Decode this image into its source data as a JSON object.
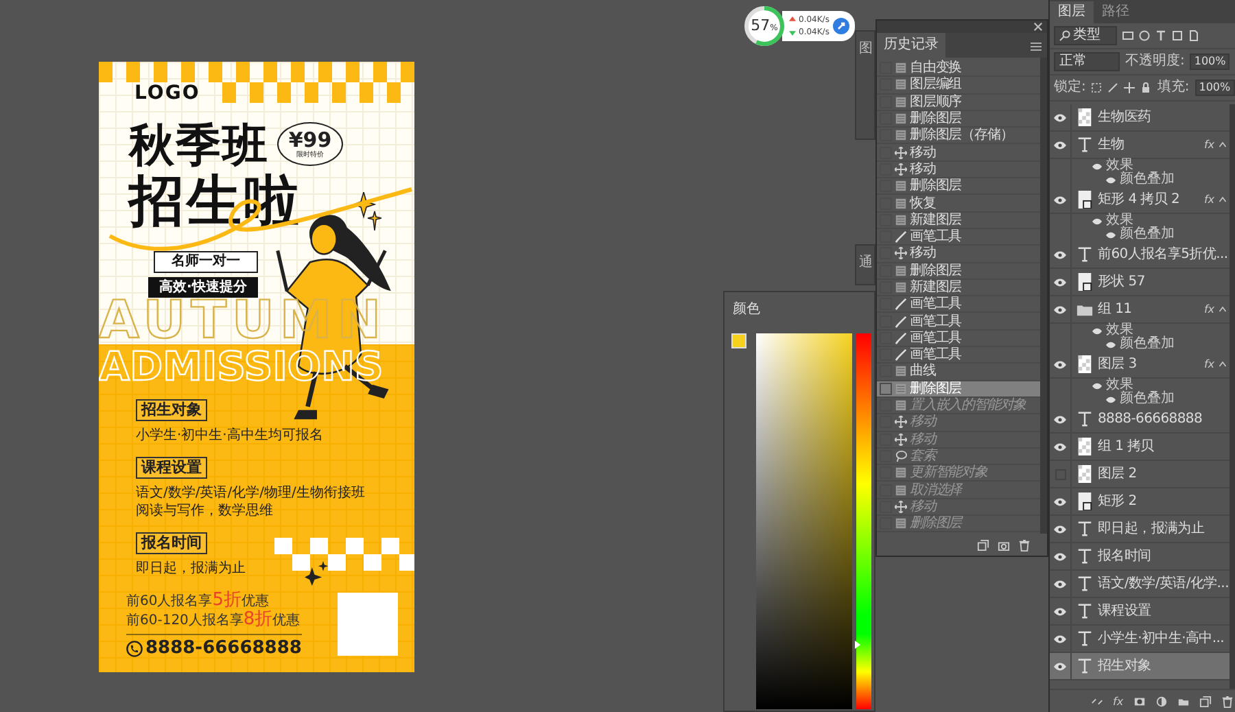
{
  "network_widget": {
    "usage": "57",
    "unit": "%",
    "level": 0.57,
    "upload": "0.04K/s",
    "download": "0.04K/s"
  },
  "poster": {
    "logo": "LOGO",
    "title_line1": "秋季班",
    "title_line2": "招生啦",
    "price": "¥99",
    "price_note": "限时特价",
    "tag1": "名师一对一",
    "tag2": "高效·快速提分",
    "bg_word1": "AUTUMN",
    "bg_word2": "ADMISSIONS",
    "sections": [
      {
        "heading": "招生对象",
        "lines": [
          "小学生·初中生·高中生均可报名"
        ]
      },
      {
        "heading": "课程设置",
        "lines": [
          "语文/数学/英语/化学/物理/生物衔接班",
          "阅读与写作，数学思维"
        ]
      },
      {
        "heading": "报名时间",
        "lines": [
          "即日起，报满为止"
        ]
      }
    ],
    "offers": [
      {
        "before": "前60人报名享",
        "highlight": "5折",
        "after": "优惠"
      },
      {
        "before": "前60-120人报名享",
        "highlight": "8折",
        "after": "优惠"
      }
    ],
    "phone": "8888-66668888"
  },
  "behind_panels": [
    {
      "tab": "图"
    },
    {
      "tab": "通"
    }
  ],
  "color_panel": {
    "title": "颜色",
    "hue_slider": {
      "level": 0.17
    }
  },
  "history_panel": {
    "title": "历史记录",
    "items": [
      {
        "label": "自由变换",
        "kind": "folder",
        "selected": false,
        "disabled": false
      },
      {
        "label": "图层编组",
        "kind": "folder",
        "selected": false,
        "disabled": false
      },
      {
        "label": "图层顺序",
        "kind": "folder",
        "selected": false,
        "disabled": false
      },
      {
        "label": "删除图层",
        "kind": "folder",
        "selected": false,
        "disabled": false
      },
      {
        "label": "删除图层（存储）",
        "kind": "folder",
        "selected": false,
        "disabled": false
      },
      {
        "label": "移动",
        "kind": "move",
        "selected": false,
        "disabled": false
      },
      {
        "label": "移动",
        "kind": "move",
        "selected": false,
        "disabled": false
      },
      {
        "label": "删除图层",
        "kind": "folder",
        "selected": false,
        "disabled": false
      },
      {
        "label": "恢复",
        "kind": "folder",
        "selected": false,
        "disabled": false
      },
      {
        "label": "新建图层",
        "kind": "folder",
        "selected": false,
        "disabled": false
      },
      {
        "label": "画笔工具",
        "kind": "brush",
        "selected": false,
        "disabled": false
      },
      {
        "label": "移动",
        "kind": "move",
        "selected": false,
        "disabled": false
      },
      {
        "label": "删除图层",
        "kind": "folder",
        "selected": false,
        "disabled": false
      },
      {
        "label": "新建图层",
        "kind": "folder",
        "selected": false,
        "disabled": false
      },
      {
        "label": "画笔工具",
        "kind": "brush",
        "selected": false,
        "disabled": false
      },
      {
        "label": "画笔工具",
        "kind": "brush",
        "selected": false,
        "disabled": false
      },
      {
        "label": "画笔工具",
        "kind": "brush",
        "selected": false,
        "disabled": false
      },
      {
        "label": "画笔工具",
        "kind": "brush",
        "selected": false,
        "disabled": false
      },
      {
        "label": "曲线",
        "kind": "folder",
        "selected": false,
        "disabled": false
      },
      {
        "label": "删除图层",
        "kind": "folder",
        "selected": true,
        "disabled": false
      },
      {
        "label": "置入嵌入的智能对象",
        "kind": "folder",
        "selected": false,
        "disabled": true
      },
      {
        "label": "移动",
        "kind": "move",
        "selected": false,
        "disabled": true
      },
      {
        "label": "移动",
        "kind": "move",
        "selected": false,
        "disabled": true
      },
      {
        "label": "套索",
        "kind": "lasso",
        "selected": false,
        "disabled": true
      },
      {
        "label": "更新智能对象",
        "kind": "folder",
        "selected": false,
        "disabled": true
      },
      {
        "label": "取消选择",
        "kind": "folder",
        "selected": false,
        "disabled": true
      },
      {
        "label": "移动",
        "kind": "move",
        "selected": false,
        "disabled": true
      },
      {
        "label": "删除图层",
        "kind": "folder",
        "selected": false,
        "disabled": true
      }
    ]
  },
  "layers_panel": {
    "tabs": [
      {
        "label": "图层",
        "selected": true
      },
      {
        "label": "路径",
        "selected": false
      }
    ],
    "filter": "类型",
    "blend_mode": "正常",
    "opacity_label": "不透明度:",
    "opacity": "100%",
    "lock_label": "锁定:",
    "fill_label": "填充:",
    "fill": "100%",
    "footer_fx": "fx",
    "layers": [
      {
        "name": "生物医药",
        "kind": "image",
        "visible": true,
        "selected": false
      },
      {
        "name": "生物",
        "kind": "text",
        "visible": true,
        "selected": false,
        "badge": "fx",
        "expanded": true,
        "effects": [
          {
            "label": "效果",
            "children": [
              {
                "label": "颜色叠加"
              }
            ]
          }
        ]
      },
      {
        "name": "矩形 4 拷贝 2",
        "kind": "shape",
        "visible": true,
        "selected": false,
        "badge": "fx",
        "expanded": true,
        "effects": [
          {
            "label": "效果",
            "children": [
              {
                "label": "颜色叠加"
              }
            ]
          }
        ]
      },
      {
        "name": "前60人报名享5折优...",
        "kind": "text",
        "visible": true,
        "selected": false
      },
      {
        "name": "形状 57",
        "kind": "shape",
        "visible": true,
        "selected": false
      },
      {
        "name": "组 11",
        "kind": "group",
        "visible": true,
        "selected": false,
        "badge": "fx",
        "expanded": true,
        "effects": [
          {
            "label": "效果",
            "children": [
              {
                "label": "颜色叠加"
              }
            ]
          }
        ]
      },
      {
        "name": "图层 3",
        "kind": "image",
        "visible": true,
        "selected": false,
        "badge": "fx",
        "expanded": true,
        "effects": [
          {
            "label": "效果",
            "children": [
              {
                "label": "颜色叠加"
              }
            ]
          }
        ]
      },
      {
        "name": "8888-66668888",
        "kind": "text",
        "visible": true,
        "selected": false
      },
      {
        "name": "组 1 拷贝",
        "kind": "image",
        "visible": true,
        "selected": false
      },
      {
        "name": "图层 2",
        "kind": "image",
        "visible": false,
        "selected": false
      },
      {
        "name": "矩形 2",
        "kind": "shape",
        "visible": true,
        "selected": false
      },
      {
        "name": "即日起，报满为止",
        "kind": "text",
        "visible": true,
        "selected": false
      },
      {
        "name": "报名时间",
        "kind": "text",
        "visible": true,
        "selected": false
      },
      {
        "name": "语文/数学/英语/化学...",
        "kind": "text",
        "visible": true,
        "selected": false
      },
      {
        "name": "课程设置",
        "kind": "text",
        "visible": true,
        "selected": false
      },
      {
        "name": "小学生·初中生·高中...",
        "kind": "text",
        "visible": true,
        "selected": false
      },
      {
        "name": "招生对象",
        "kind": "text",
        "visible": true,
        "selected": true
      }
    ]
  }
}
